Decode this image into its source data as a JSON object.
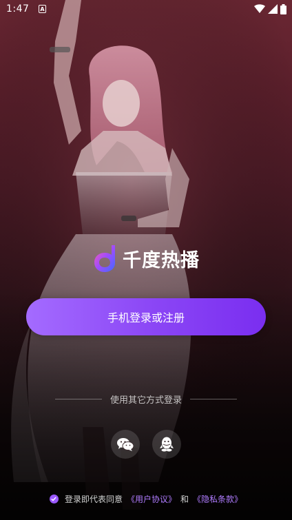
{
  "status_bar": {
    "time": "1:47",
    "notification_glyph": "A"
  },
  "app": {
    "name": "千度热播",
    "brand_color": "#8a45f5"
  },
  "login": {
    "primary_button": "手机登录或注册",
    "other_methods": "使用其它方式登录",
    "social": [
      {
        "icon": "wechat-icon"
      },
      {
        "icon": "qq-icon"
      }
    ]
  },
  "agreement": {
    "prefix": "登录即代表同意",
    "user_agreement": "《用户协议》",
    "conjunction": "和",
    "privacy_policy": "《隐私条款》",
    "checked": true
  }
}
